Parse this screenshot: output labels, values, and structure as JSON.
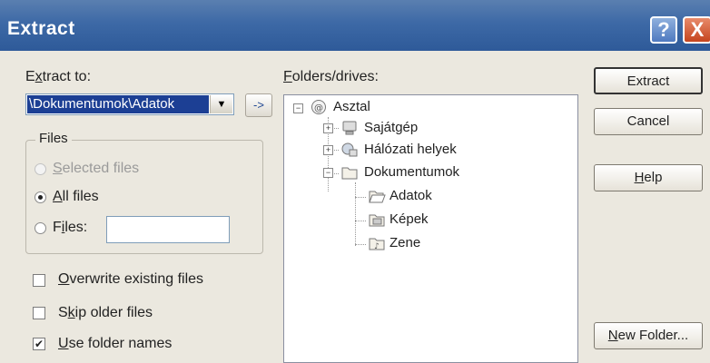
{
  "window": {
    "title": "Extract",
    "help_label": "?",
    "close_label": "X"
  },
  "extract_to": {
    "label_prefix": "E",
    "label_underline": "x",
    "label_suffix": "tract to:",
    "value": "\\Dokumentumok\\Adatok",
    "go_label": "->"
  },
  "files_group": {
    "legend": "Files",
    "selected_prefix": "",
    "selected_underline": "S",
    "selected_suffix": "elected files",
    "all_underline": "A",
    "all_suffix": "ll files",
    "files_prefix": "F",
    "files_underline": "i",
    "files_suffix": "les:",
    "files_value": "",
    "selected_mode": "all"
  },
  "options": {
    "overwrite_underline": "O",
    "overwrite_suffix": "verwrite existing files",
    "overwrite_checked": false,
    "skip_prefix": "S",
    "skip_underline": "k",
    "skip_suffix": "ip older files",
    "skip_checked": false,
    "folder_underline": "U",
    "folder_suffix": "se folder names",
    "folder_checked": true,
    "check_mark": "✔"
  },
  "folders": {
    "label_underline": "F",
    "label_suffix": "olders/drives:",
    "tree": [
      {
        "label": "Asztal",
        "icon": "desktop-icon",
        "expander": "−"
      },
      {
        "label": "Sajátgép",
        "icon": "computer-icon",
        "expander": "+"
      },
      {
        "label": "Hálózati helyek",
        "icon": "network-icon",
        "expander": "+"
      },
      {
        "label": "Dokumentumok",
        "icon": "folder-icon",
        "expander": "−"
      },
      {
        "label": "Adatok",
        "icon": "folder-open-icon",
        "expander": ""
      },
      {
        "label": "Képek",
        "icon": "pictures-folder-icon",
        "expander": ""
      },
      {
        "label": "Zene",
        "icon": "music-folder-icon",
        "expander": ""
      }
    ]
  },
  "buttons": {
    "extract": "Extract",
    "cancel": "Cancel",
    "help_underline": "H",
    "help_suffix": "elp",
    "new_folder_underline": "N",
    "new_folder_suffix": "ew Folder..."
  },
  "colors": {
    "title_bar": "#3d69a6",
    "selection": "#1c3f94",
    "dialog_bg": "#ebe8df"
  }
}
